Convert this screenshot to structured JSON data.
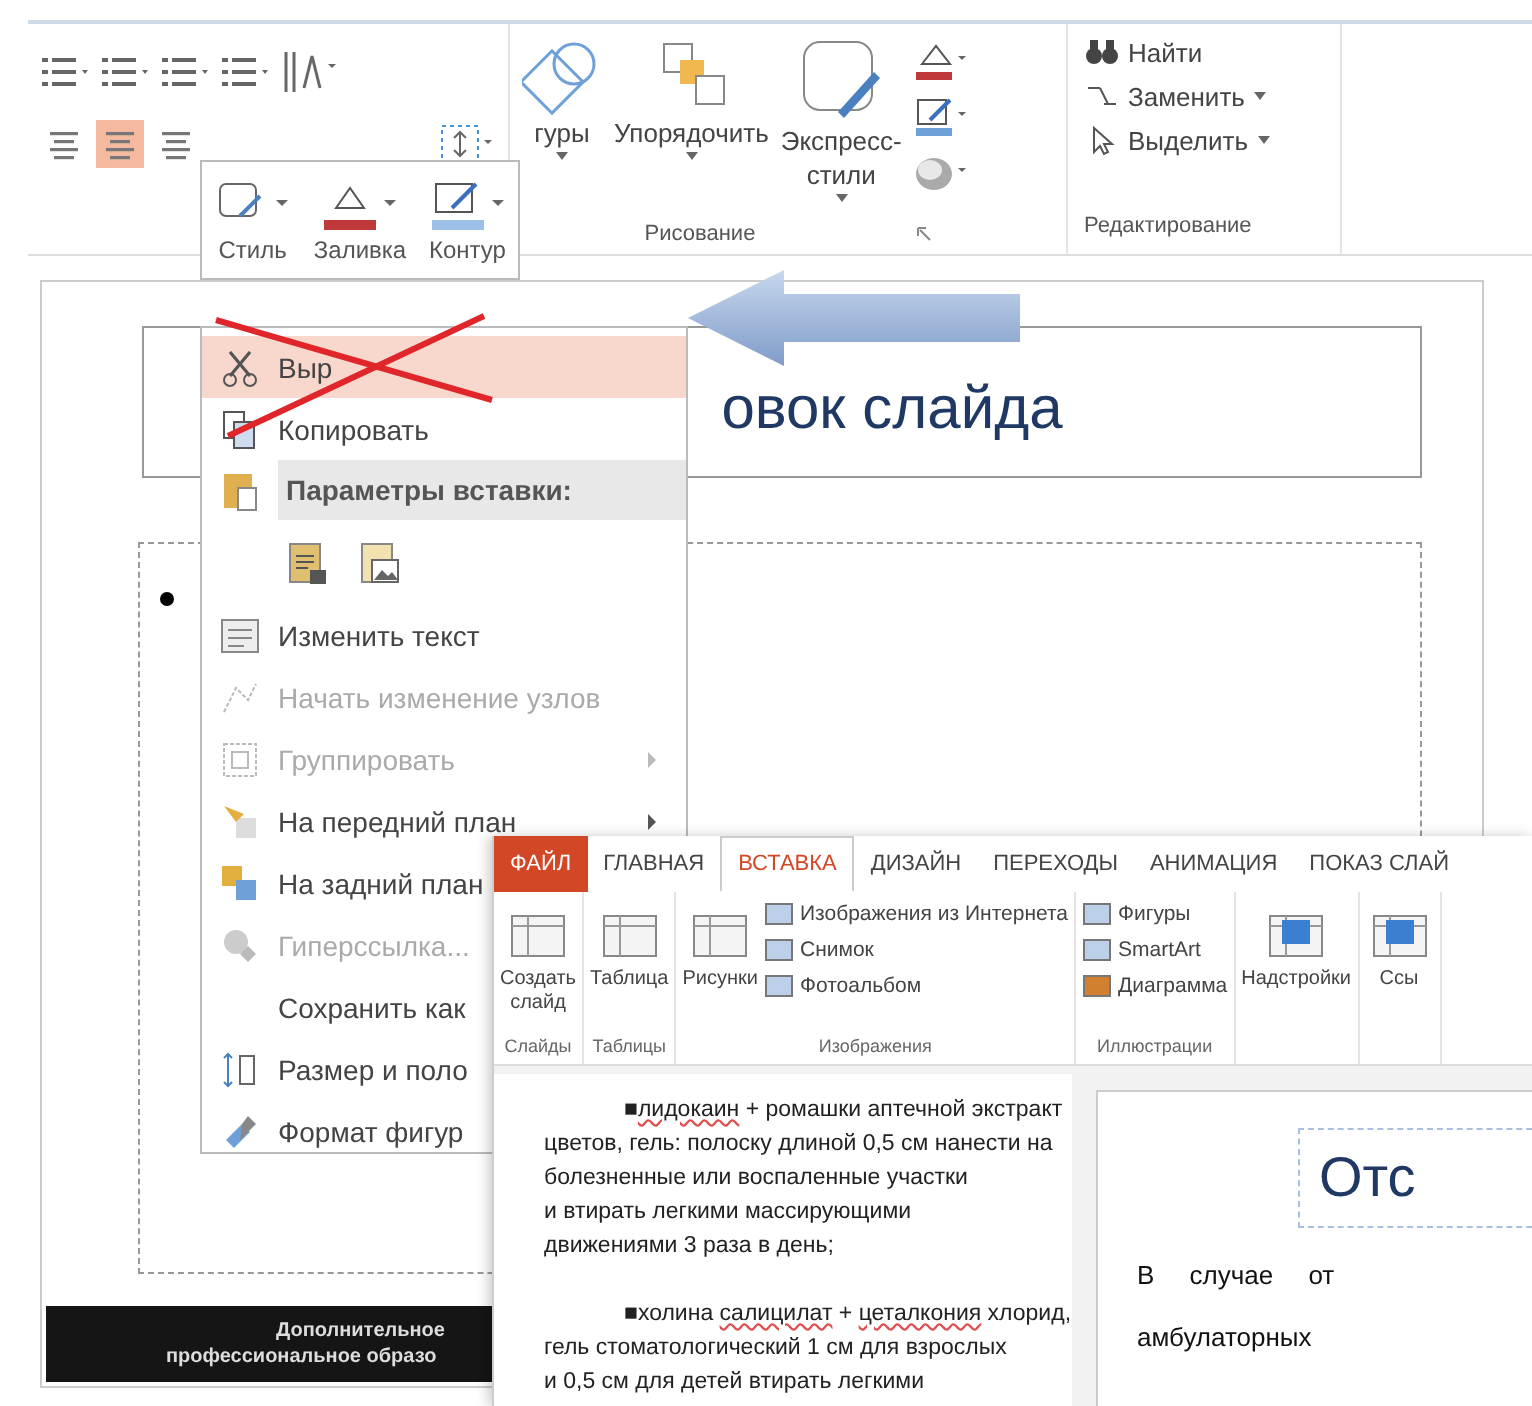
{
  "ribbon": {
    "alignment_buttons": [
      {
        "selected": false
      },
      {
        "selected": true
      },
      {
        "selected": false
      }
    ],
    "drawing_buttons": [
      {
        "lines": [
          "гуры"
        ]
      },
      {
        "lines": [
          "Упорядочить"
        ]
      },
      {
        "lines": [
          "Экспресс-",
          "стили"
        ]
      }
    ],
    "drawing_label": "Рисование",
    "editing_items": [
      "Найти",
      "Заменить",
      "Выделить"
    ],
    "editing_label": "Редактирование"
  },
  "mini_toolbar": {
    "items": [
      {
        "label": "Стиль",
        "kind": "style"
      },
      {
        "label": "Заливка",
        "kind": "fill"
      },
      {
        "label": "Контур",
        "kind": "outline"
      }
    ]
  },
  "slide": {
    "title": "овок слайда",
    "footer": [
      "Дополнительное",
      "профессиональное образо"
    ]
  },
  "context_menu": {
    "items": [
      {
        "kind": "item",
        "label": "Выр",
        "disabled": false,
        "submenu": false,
        "selected": true
      },
      {
        "kind": "item",
        "label": "Копировать",
        "disabled": false,
        "submenu": false,
        "selected": false
      },
      {
        "kind": "header",
        "label": "Параметры вставки:"
      },
      {
        "kind": "paste-options"
      },
      {
        "kind": "item",
        "label": "Изменить текст",
        "disabled": false,
        "submenu": false,
        "selected": false
      },
      {
        "kind": "item",
        "label": "Начать изменение узлов",
        "disabled": true,
        "submenu": false,
        "selected": false
      },
      {
        "kind": "item",
        "label": "Группировать",
        "disabled": true,
        "submenu": true,
        "selected": false
      },
      {
        "kind": "item",
        "label": "На передний план",
        "disabled": false,
        "submenu": true,
        "selected": false
      },
      {
        "kind": "item",
        "label": "На задний план",
        "disabled": false,
        "submenu": false,
        "selected": false
      },
      {
        "kind": "item",
        "label": "Гиперссылка...",
        "disabled": true,
        "submenu": false,
        "selected": false
      },
      {
        "kind": "item",
        "label": "Сохранить как",
        "disabled": false,
        "submenu": false,
        "selected": false
      },
      {
        "kind": "item",
        "label": "Размер и поло",
        "disabled": false,
        "submenu": false,
        "selected": false
      },
      {
        "kind": "item",
        "label": "Формат фигур",
        "disabled": false,
        "submenu": false,
        "selected": false
      }
    ]
  },
  "second_window": {
    "tabs": [
      {
        "label": "ФАЙЛ",
        "kind": "file",
        "selected": false
      },
      {
        "label": "ГЛАВНАЯ",
        "kind": "tab",
        "selected": false
      },
      {
        "label": "ВСТАВКА",
        "kind": "tab",
        "selected": true
      },
      {
        "label": "ДИЗАЙН",
        "kind": "tab",
        "selected": false
      },
      {
        "label": "ПЕРЕХОДЫ",
        "kind": "tab",
        "selected": false
      },
      {
        "label": "АНИМАЦИЯ",
        "kind": "tab",
        "selected": false
      },
      {
        "label": "ПОКАЗ СЛАЙ",
        "kind": "tab",
        "selected": false
      }
    ],
    "groups": [
      {
        "label": "Слайды",
        "large": [
          {
            "lines": [
              "Создать",
              "слайд"
            ]
          }
        ]
      },
      {
        "label": "Таблицы",
        "large": [
          {
            "lines": [
              "Таблица"
            ]
          }
        ]
      },
      {
        "label": "Изображения",
        "large": [
          {
            "lines": [
              "Рисунки"
            ]
          }
        ],
        "small": [
          "Изображения из Интернета",
          "Снимок",
          "Фотоальбом"
        ]
      },
      {
        "label": "Иллюстрации",
        "small": [
          "Фигуры",
          "SmartArt",
          "Диаграмма"
        ]
      },
      {
        "large": [
          {
            "lines": [
              "Надстройки"
            ]
          }
        ]
      },
      {
        "large": [
          {
            "lines": [
              "Ссы"
            ]
          }
        ]
      }
    ],
    "document": {
      "paragraphs": [
        {
          "bullet": "■",
          "lines": [
            [
              {
                "t": "лидокаин",
                "misspelled": true
              },
              {
                "t": " + ромашки аптечной экстракт",
                "misspelled": false
              }
            ],
            [
              {
                "t": "цветов, гель: полоску длиной 0,5 см нанести на",
                "misspelled": false
              }
            ],
            [
              {
                "t": "болезненные или воспаленные участки",
                "misspelled": false
              }
            ],
            [
              {
                "t": "и втирать легкими массирующими",
                "misspelled": false
              }
            ],
            [
              {
                "t": "движениями 3 раза в день;",
                "misspelled": false
              }
            ]
          ]
        },
        {
          "bullet": "■",
          "lines": [
            [
              {
                "t": "холина ",
                "misspelled": false
              },
              {
                "t": "салицилат",
                "misspelled": true
              },
              {
                "t": " + ",
                "misspelled": false
              },
              {
                "t": "цеталкония",
                "misspelled": true
              },
              {
                "t": " хлорид,",
                "misspelled": false
              }
            ],
            [
              {
                "t": "гель стоматологический  1 см для взрослых",
                "misspelled": false
              }
            ],
            [
              {
                "t": "и 0,5 см для детей втирать легкими",
                "misspelled": false
              }
            ]
          ]
        }
      ]
    },
    "preview": {
      "title": "Отс",
      "lines": [
        "В случае от",
        "амбулаторных"
      ]
    }
  }
}
